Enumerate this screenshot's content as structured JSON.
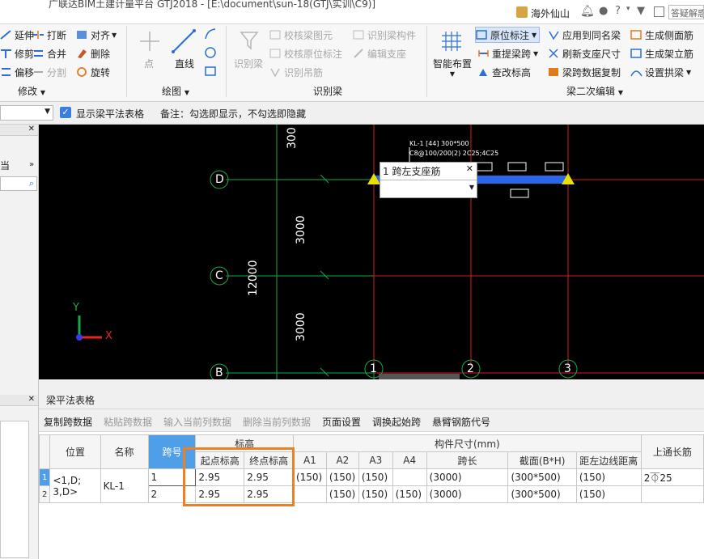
{
  "window": {
    "title": "广联达BIM土建计量平台 GTJ2018 - [E:\\document\\sun-18(GTJ\\实训\\C9)]"
  },
  "topbar": {
    "username": "海外仙山",
    "search_placeholder": "答疑解惑"
  },
  "ribbon": {
    "modify": {
      "label": "修改",
      "items": [
        "延伸",
        "打断",
        "对齐",
        "修剪",
        "合并",
        "删除",
        "偏移",
        "分割",
        "旋转"
      ]
    },
    "draw": {
      "label": "绘图",
      "point": "点",
      "line": "直线"
    },
    "recognize": {
      "label": "识别梁",
      "big": "识别梁",
      "items": [
        "校核梁图元",
        "识别梁构件",
        "校核原位标注",
        "编辑支座",
        "识别吊筋"
      ]
    },
    "beam2": {
      "label": "梁二次编辑",
      "smart": "智能布置",
      "items": [
        "原位标注",
        "应用到同名梁",
        "生成侧面筋",
        "重提梁跨",
        "刷新支座尺寸",
        "生成架立筋",
        "查改标高",
        "梁跨数据复制",
        "设置拱梁"
      ]
    }
  },
  "optbar": {
    "checkbox_label": "显示梁平法表格",
    "note": "备注：勾选即显示，不勾选即隐藏"
  },
  "leftpanel": {
    "tab_label": "当"
  },
  "canvas": {
    "axes_rows": [
      "D",
      "C",
      "B"
    ],
    "axes_cols": [
      "1",
      "2",
      "3"
    ],
    "dims": {
      "top": "300",
      "mid1": "3000",
      "mid2": "3000",
      "total": "12000"
    },
    "beam_label_1": "KL-1 [44] 300*500",
    "beam_label_2": "C8@100/200(2) 2C25;4C25",
    "popup_title": "1 跨左支座筋",
    "popup_value": "",
    "ucs_x": "X",
    "ucs_y": "Y"
  },
  "table_panel": {
    "title": "梁平法表格",
    "toolbar": [
      "复制跨数据",
      "粘贴跨数据",
      "输入当前列数据",
      "删除当前列数据",
      "页面设置",
      "调换起始跨",
      "悬臂钢筋代号"
    ],
    "group_headers": {
      "elev": "标高",
      "size": "构件尺寸(mm)"
    },
    "headers": {
      "pos": "位置",
      "name": "名称",
      "span": "跨号",
      "start": "起点标高",
      "end": "终点标高",
      "a1": "A1",
      "a2": "A2",
      "a3": "A3",
      "a4": "A4",
      "len": "跨长",
      "sect": "截面(B*H)",
      "edge": "距左边线距离",
      "top": "上通长筋"
    },
    "row_numbers": [
      "1",
      "2"
    ],
    "member": {
      "pos": "<1,D;\n3,D>",
      "name": "KL-1"
    },
    "rows": [
      {
        "span": "1",
        "start": "2.95",
        "end": "2.95",
        "a1": "(150)",
        "a2": "(150)",
        "a3": "(150)",
        "a4": "",
        "len": "(3000)",
        "sect": "(300*500)",
        "edge": "(150)",
        "top": "2⏁25"
      },
      {
        "span": "2",
        "start": "2.95",
        "end": "2.95",
        "a1": "",
        "a2": "(150)",
        "a3": "(150)",
        "a4": "(150)",
        "len": "(3000)",
        "sect": "(300*500)",
        "edge": "(150)",
        "top": ""
      }
    ]
  },
  "colors": {
    "highlight": "#ee7f26",
    "selected_header": "#4f9fe8",
    "canvas_bg": "#000000",
    "beam": "#2a66e8",
    "grid_red": "#d21e1e",
    "grid_green": "#1aa84a"
  }
}
